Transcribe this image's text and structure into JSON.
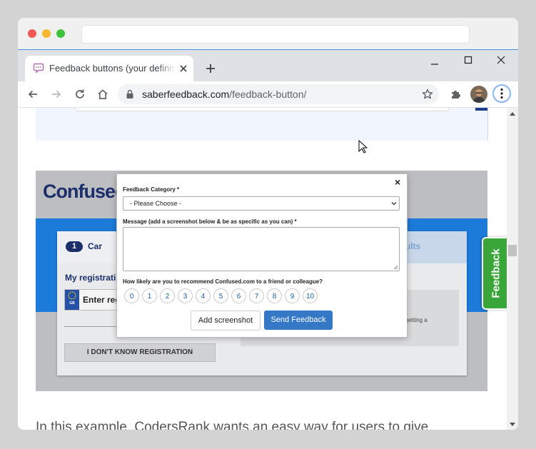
{
  "browser": {
    "tab_title": "Feedback buttons (your definitive guide)",
    "url_host": "saberfeedback.com",
    "url_path": "/feedback-button/"
  },
  "embedded_page": {
    "brand": "Confused",
    "step_number": "1",
    "step_label": "Car",
    "results_label": "ults",
    "registration_label": "My registrati",
    "reg_input_text": "Enter reg",
    "plate_country": "GB",
    "dont_know_button": "I DON'T KNOW REGISTRATION",
    "side_note": "getting a"
  },
  "modal": {
    "category_label": "Feedback Category *",
    "category_selected": "- Please Choose -",
    "message_label": "Message (add a screenshot below & be as specific as you can) *",
    "message_value": "",
    "nps_label": "How likely are you to recommend Confused.com to a friend or colleague?",
    "nps_options": [
      "0",
      "1",
      "2",
      "3",
      "4",
      "5",
      "6",
      "7",
      "8",
      "9",
      "10"
    ],
    "add_screenshot": "Add screenshot",
    "send_feedback": "Send Feedback",
    "close_glyph": "×"
  },
  "feedback_tab": {
    "label": "Feedback"
  },
  "article": {
    "text": "In this example, CodersRank wants an easy way for users to give"
  },
  "colors": {
    "brand_navy": "#1c2f6b",
    "panel_blue": "#1c7ad9",
    "send_button": "#3478c6",
    "feedback_tab": "#3aa63a"
  }
}
